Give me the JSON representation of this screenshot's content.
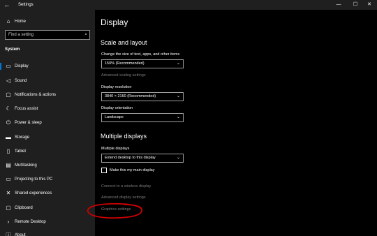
{
  "window": {
    "title": "Settings",
    "back_glyph": "←",
    "minimize_glyph": "—",
    "maximize_glyph": "☐",
    "close_glyph": "✕"
  },
  "sidebar": {
    "home_label": "Home",
    "home_icon": "home-icon",
    "search_placeholder": "Find a setting",
    "search_icon": "search-icon",
    "section_title": "System",
    "items": [
      {
        "label": "Display",
        "icon": "monitor-icon",
        "glyph": "▭",
        "active": true
      },
      {
        "label": "Sound",
        "icon": "speaker-icon",
        "glyph": "◁"
      },
      {
        "label": "Notifications & actions",
        "icon": "notifications-icon",
        "glyph": "▢"
      },
      {
        "label": "Focus assist",
        "icon": "moon-icon",
        "glyph": "☾"
      },
      {
        "label": "Power & sleep",
        "icon": "power-icon",
        "glyph": "⏻"
      },
      {
        "label": "Storage",
        "icon": "storage-icon",
        "glyph": "▬"
      },
      {
        "label": "Tablet",
        "icon": "tablet-icon",
        "glyph": "▯"
      },
      {
        "label": "Multitasking",
        "icon": "multitasking-icon",
        "glyph": "▤"
      },
      {
        "label": "Projecting to this PC",
        "icon": "projecting-icon",
        "glyph": "▭"
      },
      {
        "label": "Shared experiences",
        "icon": "shared-icon",
        "glyph": "✕"
      },
      {
        "label": "Clipboard",
        "icon": "clipboard-icon",
        "glyph": "▢"
      },
      {
        "label": "Remote Desktop",
        "icon": "remote-desktop-icon",
        "glyph": "›"
      },
      {
        "label": "About",
        "icon": "info-icon",
        "glyph": "ⓘ"
      }
    ]
  },
  "main": {
    "page_title": "Display",
    "scale_layout": {
      "heading": "Scale and layout",
      "text_size_label": "Change the size of text, apps, and other items",
      "text_size_value": "150% (Recommended)",
      "advanced_scaling_link": "Advanced scaling settings",
      "resolution_label": "Display resolution",
      "resolution_value": "3840 × 2160 (Recommended)",
      "orientation_label": "Display orientation",
      "orientation_value": "Landscape"
    },
    "multiple_displays": {
      "heading": "Multiple displays",
      "label": "Multiple displays",
      "value": "Extend desktop to this display",
      "main_display_checkbox_label": "Make this my main display",
      "main_display_checked": false,
      "wireless_link": "Connect to a wireless display",
      "advanced_display_link": "Advanced display settings",
      "graphics_link": "Graphics settings"
    },
    "dropdown_chevron": "⌄"
  },
  "annotation_color": "#cc0000",
  "accent_color": "#0078d7"
}
